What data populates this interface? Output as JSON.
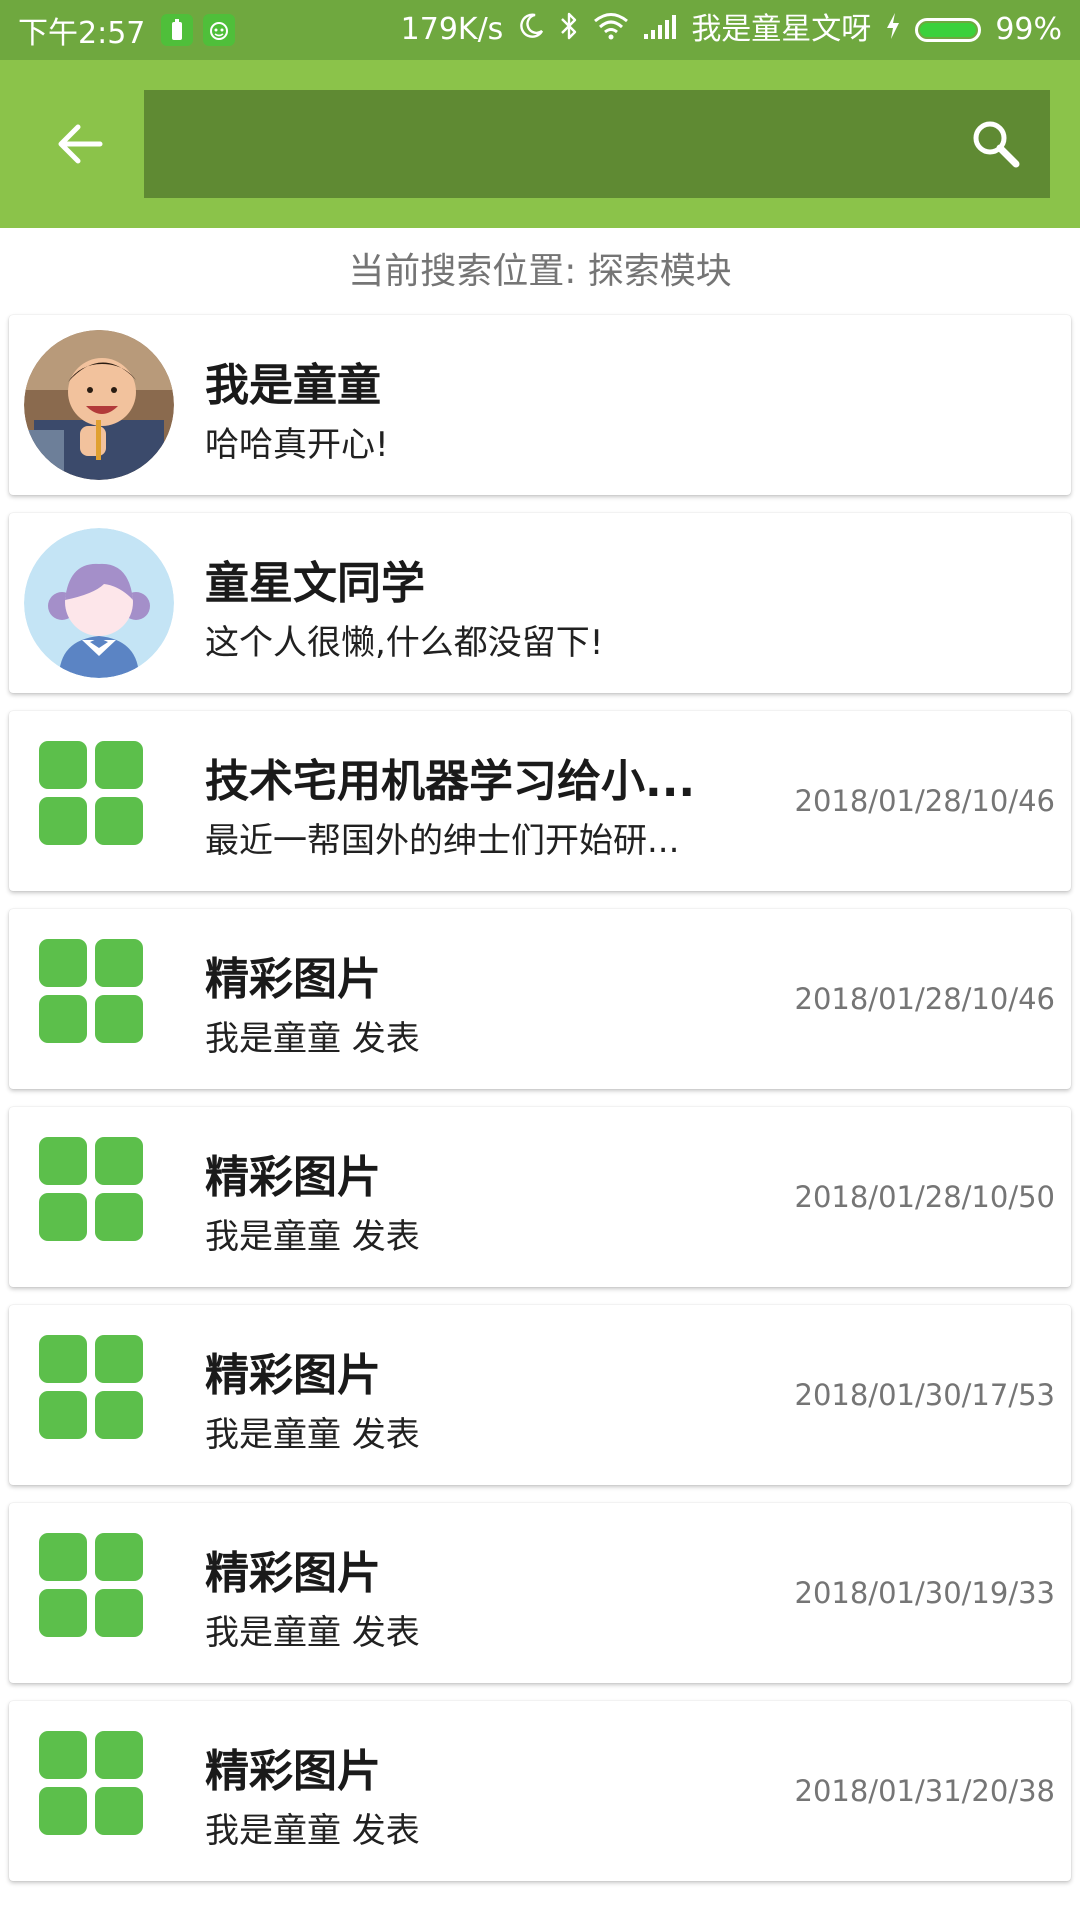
{
  "status_bar": {
    "time": "下午2:57",
    "speed": "179K/s",
    "carrier": "我是童星文呀",
    "battery_text": "99%",
    "battery_level": 0.99
  },
  "search": {
    "placeholder": ""
  },
  "location_label": "当前搜索位置: 探索模块",
  "colors": {
    "status_bar": "#6fa83f",
    "app_bar": "#8bc34a",
    "search_box": "#5f8a33",
    "grid_icon": "#5cbf4b"
  },
  "results": [
    {
      "kind": "user",
      "title": "我是童童",
      "subtitle": "哈哈真开心!",
      "date": "",
      "icon": "child-photo-avatar"
    },
    {
      "kind": "user",
      "title": "童星文同学",
      "subtitle": "这个人很懒,什么都没留下!",
      "date": "",
      "icon": "girl-avatar-icon"
    },
    {
      "kind": "post",
      "title": "技术宅用机器学习给小...",
      "subtitle": "最近一帮国外的绅士们开始研...",
      "date": "2018/01/28/10/46",
      "icon": "grid-icon"
    },
    {
      "kind": "post",
      "title": "精彩图片",
      "subtitle": "我是童童 发表",
      "date": "2018/01/28/10/46",
      "icon": "grid-icon"
    },
    {
      "kind": "post",
      "title": "精彩图片",
      "subtitle": "我是童童 发表",
      "date": "2018/01/28/10/50",
      "icon": "grid-icon"
    },
    {
      "kind": "post",
      "title": "精彩图片",
      "subtitle": "我是童童 发表",
      "date": "2018/01/30/17/53",
      "icon": "grid-icon"
    },
    {
      "kind": "post",
      "title": "精彩图片",
      "subtitle": "我是童童 发表",
      "date": "2018/01/30/19/33",
      "icon": "grid-icon"
    },
    {
      "kind": "post",
      "title": "精彩图片",
      "subtitle": "我是童童 发表",
      "date": "2018/01/31/20/38",
      "icon": "grid-icon"
    }
  ]
}
